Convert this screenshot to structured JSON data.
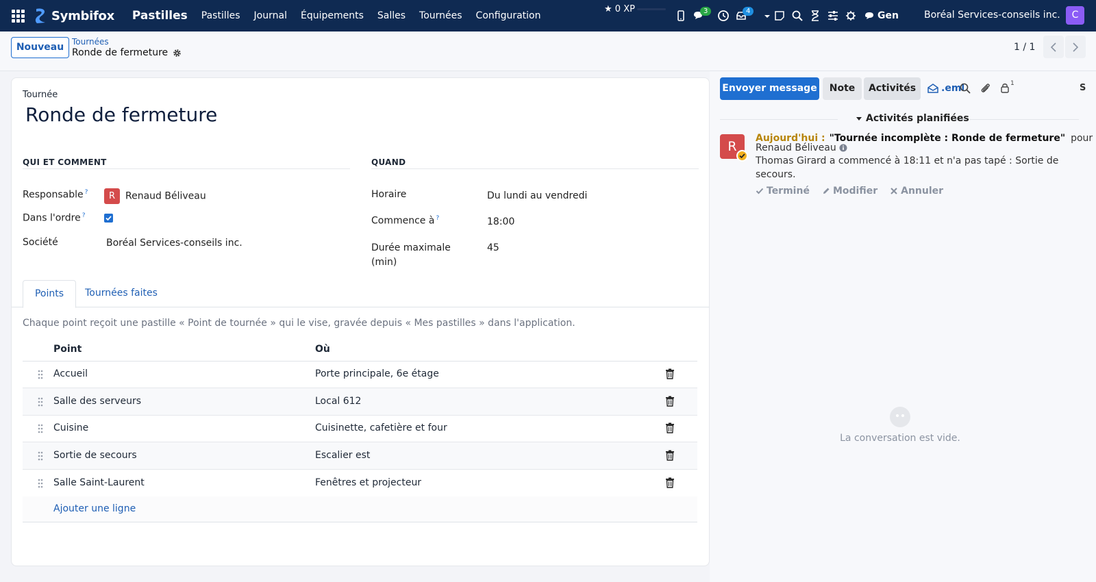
{
  "topbar": {
    "brand": "Symbifox",
    "app_name": "Pastilles",
    "nav": [
      "Pastilles",
      "Journal",
      "Équipements",
      "Salles",
      "Tournées",
      "Configuration"
    ],
    "xp": "0 XP",
    "messages_count": "3",
    "activities_count": "4",
    "gen_label": "Gen",
    "company": "Boréal Services-conseils inc.",
    "user_initial": "C"
  },
  "control": {
    "new_button": "Nouveau",
    "breadcrumb_parent": "Tournées",
    "breadcrumb_current": "Ronde de fermeture",
    "pager": "1 / 1"
  },
  "form": {
    "model_label": "Tournée",
    "title": "Ronde de fermeture",
    "section_who": "QUI ET COMMENT",
    "section_when": "QUAND",
    "responsible_label": "Responsable",
    "responsible_initial": "R",
    "responsible_value": "Renaud Béliveau",
    "ordered_label": "Dans l'ordre",
    "ordered_checked": true,
    "company_label": "Société",
    "company_value": "Boréal Services-conseils inc.",
    "help_mark": "?",
    "schedule_label": "Horaire",
    "schedule_value": "Du lundi au vendredi",
    "start_label": "Commence à",
    "start_value": "18:00",
    "duration_label_1": "Durée maximale",
    "duration_label_2": "(min)",
    "duration_value": "45"
  },
  "tabs": [
    "Points",
    "Tournées faites"
  ],
  "points": {
    "help": "Chaque point reçoit une pastille « Point de tournée » qui le vise, gravée depuis « Mes pastilles » dans l'application.",
    "col_point": "Point",
    "col_where": "Où",
    "rows": [
      {
        "point": "Accueil",
        "where": "Porte principale, 6e étage"
      },
      {
        "point": "Salle des serveurs",
        "where": "Local 612"
      },
      {
        "point": "Cuisine",
        "where": "Cuisinette, cafetière et four"
      },
      {
        "point": "Sortie de secours",
        "where": "Escalier est"
      },
      {
        "point": "Salle Saint-Laurent",
        "where": "Fenêtres et projecteur"
      }
    ],
    "add_line": "Ajouter une ligne"
  },
  "chatter": {
    "send_message": "Envoyer message",
    "note": "Note",
    "activities": "Activités",
    "eml": ".eml",
    "followers_count": "1",
    "s_label": "S",
    "planned_header": "Activités planifiées",
    "activity": {
      "avatar_initial": "R",
      "when": "Aujourd'hui :",
      "title": "\"Tournée incomplète : Ronde de fermeture\"",
      "pour": "pour",
      "assignee": "Renaud Béliveau",
      "note": "Thomas Girard a commencé à 18:11 et n'a pas tapé : Sortie de secours.",
      "done": "Terminé",
      "edit": "Modifier",
      "cancel": "Annuler"
    },
    "empty_text": "La conversation est vide."
  },
  "colors": {
    "topbar": "#0f2a52",
    "primary": "#1f6fd1",
    "avatar_red": "#d44b4b",
    "user_purple": "#8b5cf6",
    "today_gold": "#b8860b"
  }
}
